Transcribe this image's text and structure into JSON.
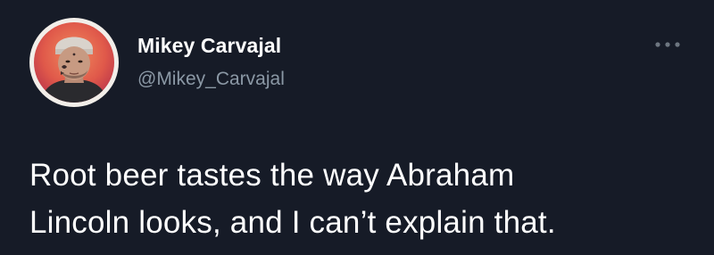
{
  "tweet": {
    "author": {
      "display_name": "Mikey Carvajal",
      "handle": "@Mikey_Carvajal",
      "avatar_icon": "profile-photo"
    },
    "more_icon": "ellipsis-icon",
    "text_lines": [
      "Root beer tastes the way Abraham",
      "Lincoln looks, and I can’t explain that."
    ]
  },
  "colors": {
    "background": "#161b27",
    "primary_text": "#ffffff",
    "secondary_text": "#8b98a5",
    "avatar_ring": "#f2eee9",
    "avatar_backdrop": "#e0594a"
  }
}
